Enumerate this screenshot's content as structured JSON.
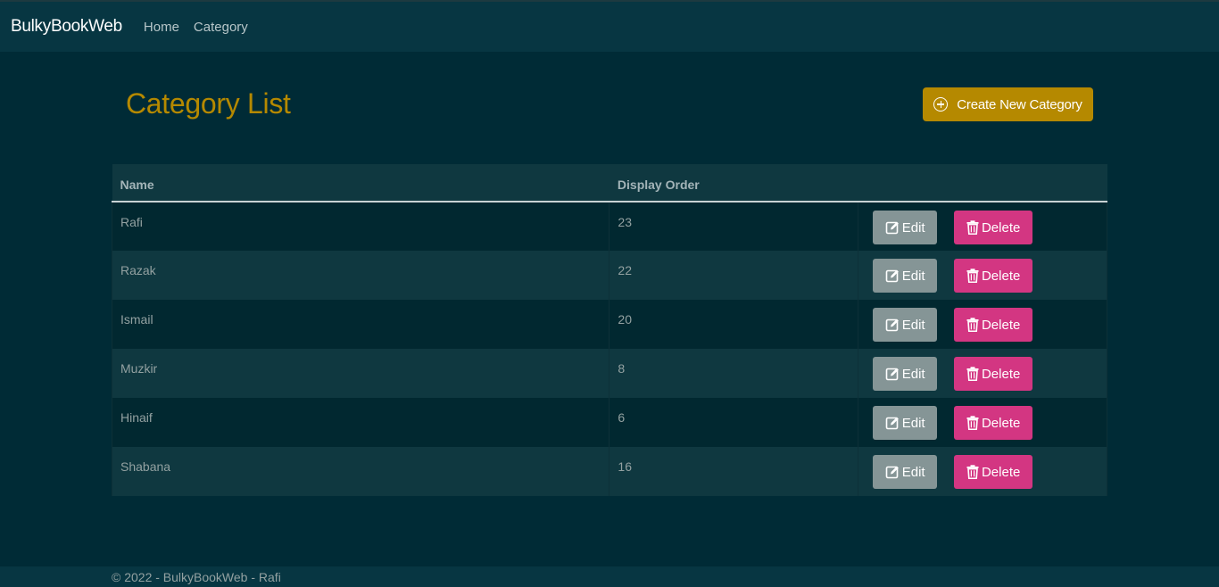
{
  "nav": {
    "brand": "BulkyBookWeb",
    "links": [
      "Home",
      "Category"
    ]
  },
  "page": {
    "title": "Category List",
    "create_button": "Create New Category"
  },
  "table": {
    "headers": [
      "Name",
      "Display Order",
      ""
    ],
    "rows": [
      {
        "name": "Rafi",
        "order": "23"
      },
      {
        "name": "Razak",
        "order": "22"
      },
      {
        "name": "Ismail",
        "order": "20"
      },
      {
        "name": "Muzkir",
        "order": "8"
      },
      {
        "name": "Hinaif",
        "order": "6"
      },
      {
        "name": "Shabana",
        "order": "16"
      }
    ],
    "edit_label": "Edit",
    "delete_label": "Delete"
  },
  "footer": {
    "text": "© 2022 - BulkyBookWeb - Rafi"
  },
  "colors": {
    "background": "#002b36",
    "navbar": "#073642",
    "accent": "#b58900",
    "delete": "#d33682",
    "edit": "#859596"
  }
}
